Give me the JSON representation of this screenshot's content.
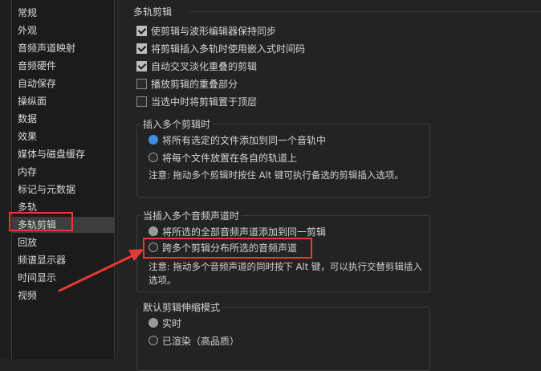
{
  "sidebar": {
    "items": [
      {
        "label": "常规"
      },
      {
        "label": "外观"
      },
      {
        "label": "音频声道映射"
      },
      {
        "label": "音频硬件"
      },
      {
        "label": "自动保存"
      },
      {
        "label": "操纵面"
      },
      {
        "label": "数据"
      },
      {
        "label": "效果"
      },
      {
        "label": "媒体与磁盘缓存"
      },
      {
        "label": "内存"
      },
      {
        "label": "标记与元数据"
      },
      {
        "label": "多轨"
      },
      {
        "label": "多轨剪辑"
      },
      {
        "label": "回放"
      },
      {
        "label": "频谱显示器"
      },
      {
        "label": "时间显示"
      },
      {
        "label": "视频"
      }
    ],
    "selected_index": 12
  },
  "main": {
    "title": "多轨剪辑",
    "checkboxes": [
      {
        "label": "使剪辑与波形编辑器保持同步",
        "checked": true
      },
      {
        "label": "将剪辑插入多轨时使用嵌入式时间码",
        "checked": true
      },
      {
        "label": "自动交叉淡化重叠的剪辑",
        "checked": true
      },
      {
        "label": "播放剪辑的重叠部分",
        "checked": false
      },
      {
        "label": "当选中时将剪辑置于顶层",
        "checked": false
      }
    ],
    "group_insert": {
      "title": "插入多个剪辑时",
      "options": [
        {
          "label": "将所有选定的文件添加到同一个音轨中",
          "selected": true
        },
        {
          "label": "将每个文件放置在各自的轨道上",
          "selected": false
        }
      ],
      "note": "注意: 拖动多个剪辑时按住 Alt 键可执行备选的剪辑插入选项。"
    },
    "group_channels": {
      "title": "当插入多个音频声道时",
      "options": [
        {
          "label": "将所选的全部音频声道添加到同一剪辑",
          "selected": true
        },
        {
          "label": "跨多个剪辑分布所选的音频声道",
          "selected": false
        }
      ],
      "note_line1": "注意: 拖动多个音频声道的同时按下 Alt 键，可以执行交替剪辑插入",
      "note_line2": "选项。"
    },
    "group_stretch": {
      "title": "默认剪辑伸缩模式",
      "options": [
        {
          "label": "实时",
          "selected": true
        },
        {
          "label": "已渲染（高品质）",
          "selected": false
        }
      ]
    }
  },
  "colors": {
    "highlight": "#e53935",
    "radio_selected": "#3d8ee8"
  }
}
